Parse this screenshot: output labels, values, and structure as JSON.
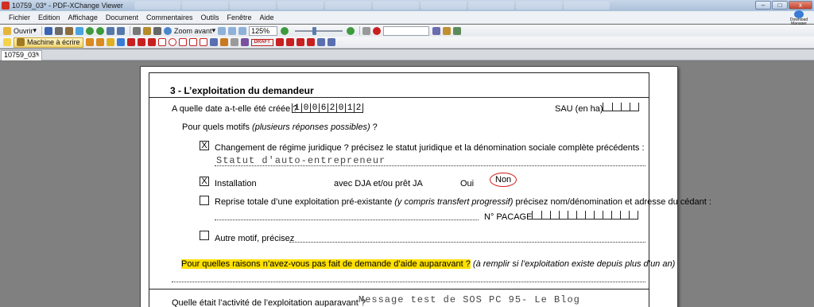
{
  "window": {
    "title": "10759_03* - PDF-XChange Viewer",
    "controls": [
      "–",
      "□",
      "x"
    ],
    "download_widget": "Download Manager"
  },
  "menu": [
    "Fichier",
    "Edition",
    "Affichage",
    "Document",
    "Commentaires",
    "Outils",
    "Fenêtre",
    "Aide"
  ],
  "toolbar": {
    "open_label": "Ouvrir",
    "zoom_label": "Zoom avant",
    "zoom_value": "125%",
    "typewriter_label": "Machine à écrire",
    "draft_stamp": "DRAFT"
  },
  "tab": {
    "name": "10759_03*",
    "close": "×"
  },
  "icons": {
    "colors": {
      "accent": "#d01a1a",
      "highlight": "#ffe000",
      "typewriter": "#f1d678"
    }
  },
  "form": {
    "section_title": "3 - L’exploitation du demandeur",
    "date_question": "A quelle date a-t-elle été créée ?",
    "date_digits": [
      "1",
      "0",
      "0",
      "6",
      "2",
      "0",
      "1",
      "2"
    ],
    "sau_label": "SAU (en ha)",
    "motifs_prefix": "Pour quels motifs ",
    "motifs_italic": "(plusieurs réponses possibles)",
    "motifs_suffix": " ?",
    "changement_checked": "X",
    "changement_label": "Changement de régime juridique ? précisez le statut juridique et la dénomination sociale complète précédents :",
    "changement_value": "Statut d'auto-entrepreneur",
    "installation_checked": "X",
    "installation_label": "Installation",
    "installation_dja": "avec DJA et/ou prêt JA",
    "installation_oui": "Oui",
    "installation_non": "Non",
    "reprise_label_a": "Reprise totale d’une exploitation pré-existante ",
    "reprise_label_italic": "(y compris transfert progressif)",
    "reprise_label_b": " précisez nom/dénomination et adresse du cédant :",
    "pacage_label": "N° PACAGE",
    "autre_label": "Autre motif, précisez",
    "raisons_question": "Pour quelles raisons n’avez-vous pas fait de demande d’aide auparavant ?",
    "raisons_note": "(à remplir si l’exploitation existe depuis plus d’un an)",
    "activite_question": "Quelle était l’activité de l’exploitation auparavant ?",
    "activite_value": "Message test de SOS PC 95- Le Blog"
  }
}
